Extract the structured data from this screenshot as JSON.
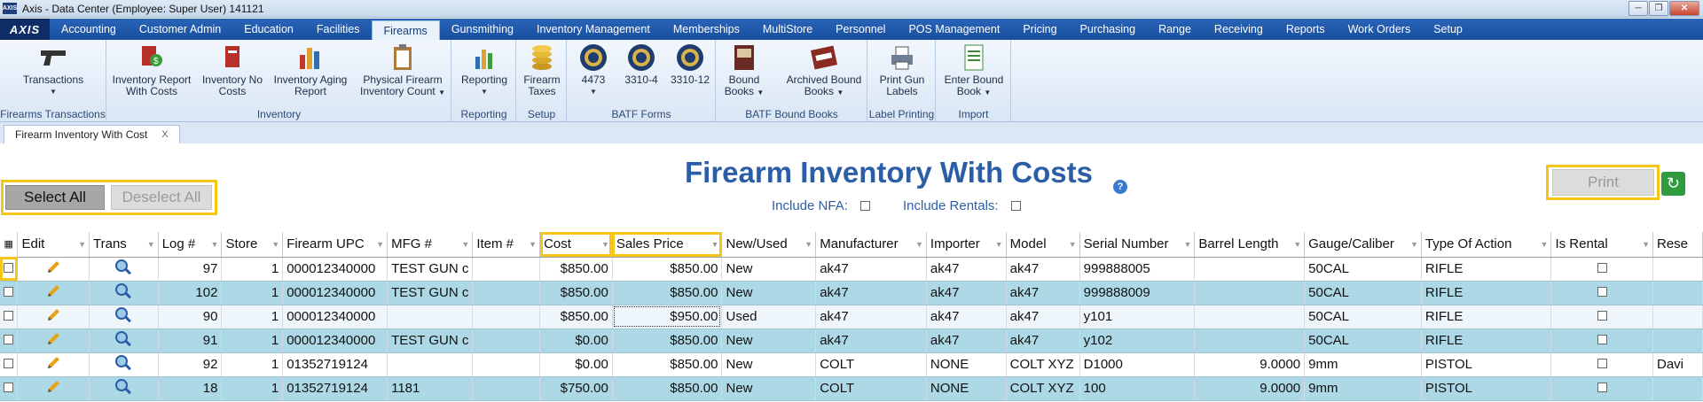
{
  "window": {
    "title": "Axis - Data Center  (Employee: Super User) 141121",
    "logo": "AXIS"
  },
  "menu": {
    "logo": "AXIS",
    "tabs": [
      "Accounting",
      "Customer Admin",
      "Education",
      "Facilities",
      "Firearms",
      "Gunsmithing",
      "Inventory Management",
      "Memberships",
      "MultiStore",
      "Personnel",
      "POS Management",
      "Pricing",
      "Purchasing",
      "Range",
      "Receiving",
      "Reports",
      "Work Orders",
      "Setup"
    ],
    "active_tab": "Firearms"
  },
  "ribbon": {
    "groups": {
      "firearms_transactions": {
        "label": "Firearms Transactions",
        "buttons": {
          "transactions": "Transactions"
        }
      },
      "inventory": {
        "label": "Inventory",
        "buttons": {
          "report_with_costs": "Inventory Report With Costs",
          "no_costs": "Inventory No Costs",
          "aging": "Inventory Aging Report",
          "physical_count": "Physical Firearm Inventory Count"
        }
      },
      "reporting": {
        "label": "Reporting",
        "buttons": {
          "reporting": "Reporting"
        }
      },
      "setup": {
        "label": "Setup",
        "buttons": {
          "taxes": "Firearm Taxes"
        }
      },
      "batf_forms": {
        "label": "BATF Forms",
        "buttons": {
          "f4473": "4473",
          "f3310_4": "3310-4",
          "f3310_12": "3310-12"
        }
      },
      "batf_bound_books": {
        "label": "BATF Bound Books",
        "buttons": {
          "bound_books": "Bound Books",
          "archived": "Archived Bound Books"
        }
      },
      "label_printing": {
        "label": "Label Printing",
        "buttons": {
          "print_labels": "Print Gun Labels"
        }
      },
      "import": {
        "label": "Import",
        "buttons": {
          "enter_bound_book": "Enter Bound Book"
        }
      }
    }
  },
  "doc_tab": {
    "label": "Firearm Inventory With Cost",
    "close": "X"
  },
  "page": {
    "title": "Firearm Inventory With Costs",
    "select_all": "Select All",
    "deselect_all": "Deselect All",
    "include_nfa_label": "Include NFA:",
    "include_rentals_label": "Include Rentals:",
    "print": "Print"
  },
  "grid": {
    "columns": [
      "Edit",
      "Trans",
      "Log #",
      "Store",
      "Firearm UPC",
      "MFG #",
      "Item #",
      "Cost",
      "Sales Price",
      "New/Used",
      "Manufacturer",
      "Importer",
      "Model",
      "Serial Number",
      "Barrel Length",
      "Gauge/Caliber",
      "Type Of Action",
      "Is Rental",
      "Rese"
    ],
    "rows": [
      {
        "log": "97",
        "store": "1",
        "upc": "000012340000",
        "mfg": "TEST GUN c",
        "item": "",
        "cost": "$850.00",
        "price": "$850.00",
        "new_used": "New",
        "manufacturer": "ak47",
        "importer": "ak47",
        "model": "ak47",
        "serial": "999888005",
        "barrel": "",
        "caliber": "50CAL",
        "action": "RIFLE",
        "rese": ""
      },
      {
        "log": "102",
        "store": "1",
        "upc": "000012340000",
        "mfg": "TEST GUN c",
        "item": "",
        "cost": "$850.00",
        "price": "$850.00",
        "new_used": "New",
        "manufacturer": "ak47",
        "importer": "ak47",
        "model": "ak47",
        "serial": "999888009",
        "barrel": "",
        "caliber": "50CAL",
        "action": "RIFLE",
        "rese": ""
      },
      {
        "log": "90",
        "store": "1",
        "upc": "000012340000",
        "mfg": "",
        "item": "",
        "cost": "$850.00",
        "price": "$950.00",
        "new_used": "Used",
        "manufacturer": "ak47",
        "importer": "ak47",
        "model": "ak47",
        "serial": "y101",
        "barrel": "",
        "caliber": "50CAL",
        "action": "RIFLE",
        "rese": ""
      },
      {
        "log": "91",
        "store": "1",
        "upc": "000012340000",
        "mfg": "TEST GUN c",
        "item": "",
        "cost": "$0.00",
        "price": "$850.00",
        "new_used": "New",
        "manufacturer": "ak47",
        "importer": "ak47",
        "model": "ak47",
        "serial": "y102",
        "barrel": "",
        "caliber": "50CAL",
        "action": "RIFLE",
        "rese": ""
      },
      {
        "log": "92",
        "store": "1",
        "upc": "01352719124",
        "mfg": "",
        "item": "",
        "cost": "$0.00",
        "price": "$850.00",
        "new_used": "New",
        "manufacturer": "COLT",
        "importer": "NONE",
        "model": "COLT XYZ",
        "serial": "D1000",
        "barrel": "9.0000",
        "caliber": "9mm",
        "action": "PISTOL",
        "rese": "Davi"
      },
      {
        "log": "18",
        "store": "1",
        "upc": "01352719124",
        "mfg": "1181",
        "item": "",
        "cost": "$750.00",
        "price": "$850.00",
        "new_used": "New",
        "manufacturer": "COLT",
        "importer": "NONE",
        "model": "COLT XYZ",
        "serial": "100",
        "barrel": "9.0000",
        "caliber": "9mm",
        "action": "PISTOL",
        "rese": ""
      }
    ]
  },
  "colors": {
    "accent": "#2c5ea8",
    "highlight": "#f5c518",
    "row_alt": "#add8e6",
    "menubar": "#1f5aab"
  }
}
